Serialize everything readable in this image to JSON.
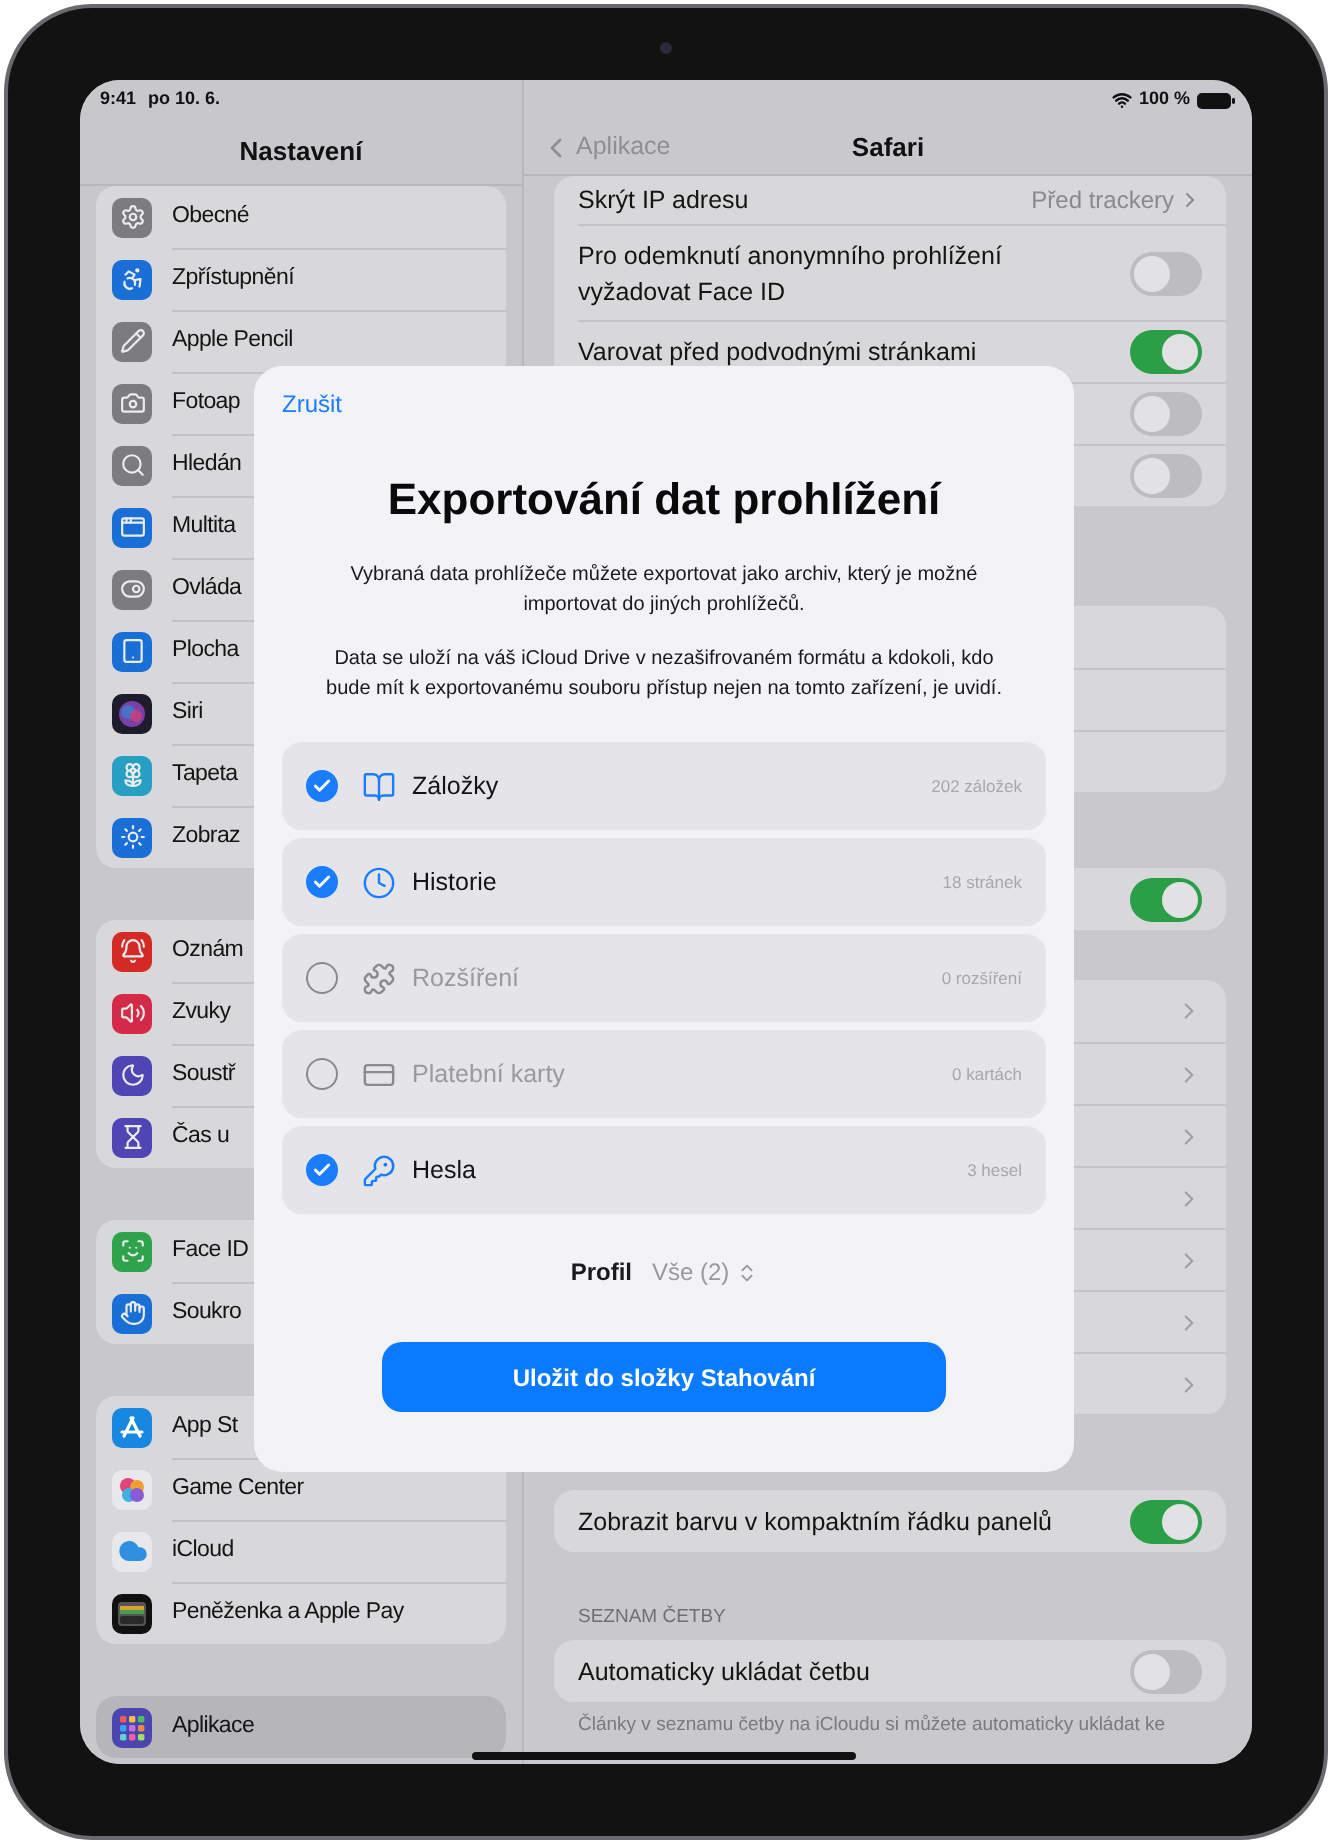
{
  "status_bar": {
    "time": "9:41",
    "date": "po 10. 6.",
    "battery": "100 %"
  },
  "sidebar": {
    "title": "Nastavení",
    "groups": [
      {
        "items": [
          {
            "label": "Obecné",
            "selected": false
          },
          {
            "label": "Zpřístupnění",
            "selected": false
          },
          {
            "label": "Apple Pencil",
            "selected": false
          },
          {
            "label": "Fotoap",
            "selected": false
          },
          {
            "label": "Hledán",
            "selected": false
          },
          {
            "label": "Multita",
            "selected": false
          },
          {
            "label": "Ovláda",
            "selected": false
          },
          {
            "label": "Plocha",
            "selected": false
          },
          {
            "label": "Siri",
            "selected": false
          },
          {
            "label": "Tapeta",
            "selected": false
          },
          {
            "label": "Zobraz",
            "selected": false
          }
        ]
      },
      {
        "items": [
          {
            "label": "Oznám",
            "selected": false
          },
          {
            "label": "Zvuky",
            "selected": false
          },
          {
            "label": "Soustř",
            "selected": false
          },
          {
            "label": "Čas u",
            "selected": false
          }
        ]
      },
      {
        "items": [
          {
            "label": "Face ID",
            "selected": false
          },
          {
            "label": "Soukro",
            "selected": false
          }
        ]
      },
      {
        "items": [
          {
            "label": "App St",
            "selected": false
          },
          {
            "label": "Game Center",
            "selected": false
          },
          {
            "label": "iCloud",
            "selected": false
          },
          {
            "label": "Peněženka a Apple Pay",
            "selected": false
          }
        ]
      },
      {
        "items": [
          {
            "label": "Aplikace",
            "selected": true
          }
        ]
      }
    ]
  },
  "detail": {
    "back": "Aplikace",
    "title": "Safari",
    "groups": [
      {
        "rows": [
          {
            "kind": "value",
            "label": "Skrýt IP adresu",
            "value": "Před trackery"
          },
          {
            "kind": "toggle",
            "label": "Pro odemknutí anonymního prohlížení vyžadovat Face ID",
            "on": false
          },
          {
            "kind": "toggle",
            "label": "Varovat před podvodnými stránkami",
            "on": true
          },
          {
            "kind": "toggle",
            "on": false
          },
          {
            "kind": "toggle",
            "on": false
          }
        ]
      },
      {
        "rows": [
          {
            "kind": "blank"
          },
          {
            "kind": "blank"
          },
          {
            "kind": "blank"
          }
        ]
      },
      {
        "rows": [
          {
            "kind": "toggle",
            "on": true
          }
        ]
      },
      {
        "rows": [
          {
            "kind": "link"
          },
          {
            "kind": "link"
          },
          {
            "kind": "link"
          },
          {
            "kind": "link"
          },
          {
            "kind": "link"
          },
          {
            "kind": "link"
          },
          {
            "kind": "link"
          }
        ]
      },
      {
        "rows": [
          {
            "kind": "toggle",
            "label": "Zobrazit barvu v kompaktním řádku panelů",
            "on": true
          }
        ]
      },
      {
        "header": "SEZNAM ČETBY",
        "rows": [
          {
            "kind": "toggle",
            "label": "Automaticky ukládat četbu",
            "on": false
          }
        ],
        "footer": "Články v seznamu četby na iCloudu si můžete automaticky ukládat ke"
      }
    ]
  },
  "dialog": {
    "cancel": "Zrušit",
    "title": "Exportování dat prohlížení",
    "paragraphs": [
      "Vybraná data prohlížeče můžete exportovat jako archiv, který je možné importovat do jiných prohlížečů.",
      "Data se uloží na váš iCloud Drive v nezašifrovaném formátu a kdokoli, kdo bude mít k exportovanému souboru přístup nejen na tomto zařízení, je uvidí."
    ],
    "items": [
      {
        "label": "Záložky",
        "count": "202 záložek",
        "checked": true,
        "disabled": false
      },
      {
        "label": "Historie",
        "count": "18 stránek",
        "checked": true,
        "disabled": false
      },
      {
        "label": "Rozšíření",
        "count": "0 rozšíření",
        "checked": false,
        "disabled": true
      },
      {
        "label": "Platební karty",
        "count": "0 kartách",
        "checked": false,
        "disabled": true
      },
      {
        "label": "Hesla",
        "count": "3 hesel",
        "checked": true,
        "disabled": false
      }
    ],
    "profile": {
      "label": "Profil",
      "value": "Vše (2)"
    },
    "button": "Uložit do složky Stahování"
  }
}
